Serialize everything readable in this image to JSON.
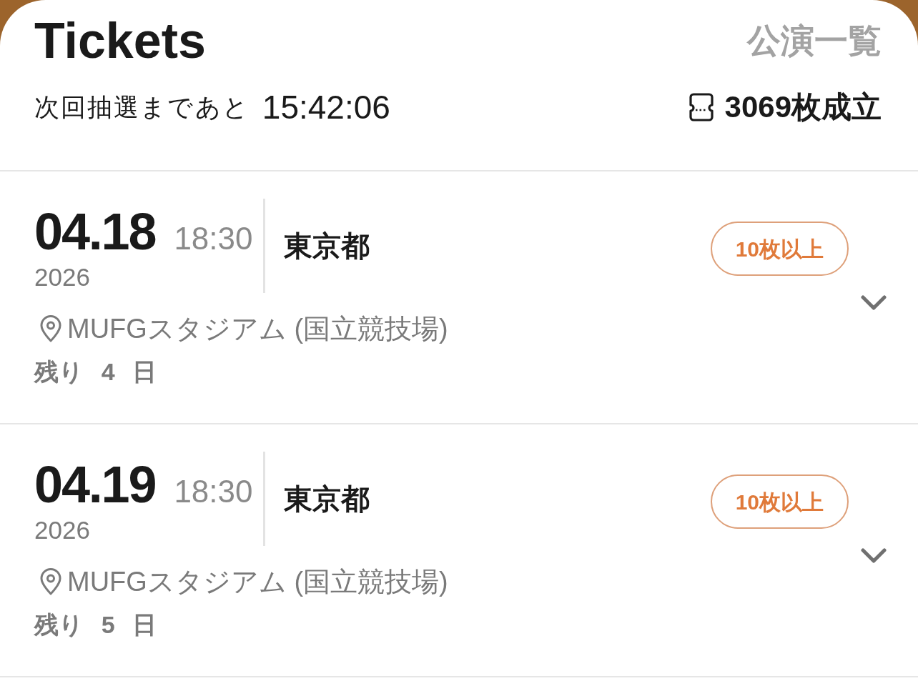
{
  "header": {
    "title": "Tickets",
    "link": "公演一覧",
    "countdown_label": "次回抽選まであと",
    "countdown": "15:42:06",
    "tickets_count": "3069枚成立"
  },
  "events": [
    {
      "date": "04.18",
      "time": "18:30",
      "year": "2026",
      "city": "東京都",
      "badge": "10枚以上",
      "venue": "MUFGスタジアム (国立競技場)",
      "remaining": "残り 4 日",
      "expanded": false
    },
    {
      "date": "04.19",
      "time": "18:30",
      "year": "2026",
      "city": "東京都",
      "badge": "10枚以上",
      "venue": "MUFGスタジアム (国立競技場)",
      "remaining": "残り 5 日",
      "expanded": false
    }
  ]
}
